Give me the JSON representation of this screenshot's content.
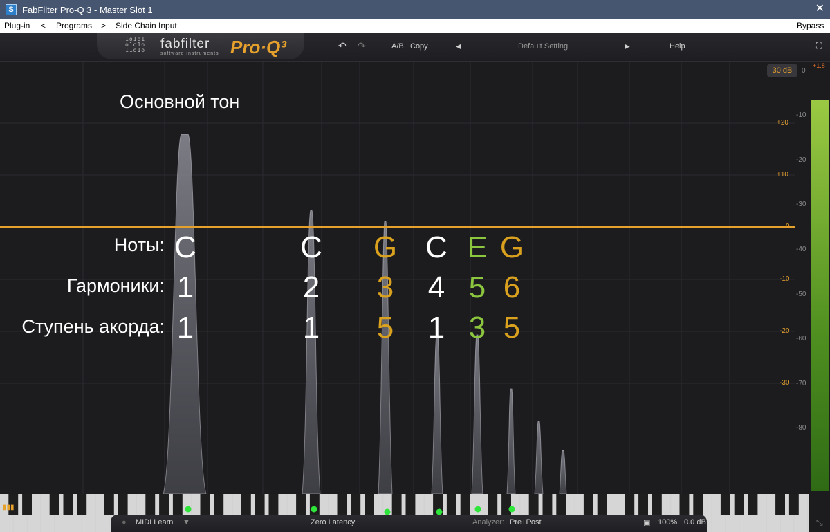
{
  "window": {
    "title": "FabFilter Pro-Q 3 - Master Slot 1",
    "icon": "S",
    "close": "✕"
  },
  "menu": {
    "plugin": "Plug-in",
    "prev": "<",
    "programs": "Programs",
    "next": ">",
    "sidechain": "Side Chain Input",
    "bypass": "Bypass"
  },
  "header": {
    "brand_bits": [
      "1o1o1",
      "o1o1o",
      "11o1o"
    ],
    "brand": "fabfilter",
    "brand_sub": "software instruments",
    "product": "Pro·Q³",
    "undo": "↶",
    "redo": "↷",
    "ab": "A/B",
    "copy": "Copy",
    "prev_preset": "◀",
    "preset": "Default Setting",
    "next_preset": "▶",
    "help": "Help",
    "fullscreen": "⛶"
  },
  "display": {
    "range": "30 dB",
    "meter_peak": "+1.8",
    "meter_level": 0.92
  },
  "gain_scale": [
    "+20",
    "+10",
    "0",
    "-10",
    "-20",
    "-30"
  ],
  "analyzer_scale": [
    "0",
    "-10",
    "-20",
    "-30",
    "-40",
    "-50",
    "-60",
    "-70",
    "-80"
  ],
  "overlay": {
    "title": "Основной тон",
    "notes_label": "Ноты:",
    "harmonics_label": "Гармоники:",
    "degree_label": "Ступень акорда:"
  },
  "harmonics": [
    {
      "note": "C",
      "harmonic": "1",
      "degree": "1",
      "color": "#ffffff"
    },
    {
      "note": "C",
      "harmonic": "2",
      "degree": "1",
      "color": "#ffffff"
    },
    {
      "note": "G",
      "harmonic": "3",
      "degree": "5",
      "color": "#d9a11e"
    },
    {
      "note": "C",
      "harmonic": "4",
      "degree": "1",
      "color": "#ffffff"
    },
    {
      "note": "E",
      "harmonic": "5",
      "degree": "3",
      "color": "#8cc63f"
    },
    {
      "note": "G",
      "harmonic": "6",
      "degree": "5",
      "color": "#d9a11e"
    }
  ],
  "footer": {
    "midi_learn": "MIDI Learn",
    "latency": "Zero Latency",
    "analyzer_label": "Analyzer:",
    "analyzer_value": "Pre+Post",
    "zoom": "100%",
    "gain": "0.0 dB"
  },
  "colors": {
    "accent": "#e6a12d",
    "green_note": "#8cc63f",
    "gold_note": "#d9a11e"
  }
}
